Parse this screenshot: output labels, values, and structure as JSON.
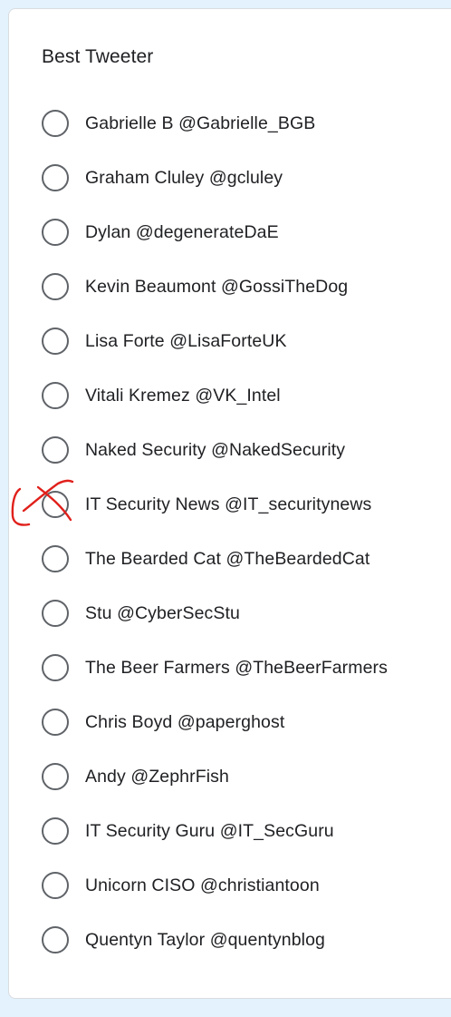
{
  "question": {
    "title": "Best Tweeter"
  },
  "options": [
    {
      "label": "Gabrielle B @Gabrielle_BGB"
    },
    {
      "label": "Graham Cluley @gcluley"
    },
    {
      "label": "Dylan @degenerateDaE"
    },
    {
      "label": "Kevin Beaumont @GossiTheDog"
    },
    {
      "label": "Lisa Forte @LisaForteUK"
    },
    {
      "label": "Vitali Kremez @VK_Intel"
    },
    {
      "label": "Naked Security @NakedSecurity"
    },
    {
      "label": "IT Security News @IT_securitynews"
    },
    {
      "label": "The Bearded Cat @TheBeardedCat"
    },
    {
      "label": "Stu @CyberSecStu"
    },
    {
      "label": "The Beer Farmers @TheBeerFarmers"
    },
    {
      "label": "Chris Boyd @paperghost"
    },
    {
      "label": "Andy @ZephrFish"
    },
    {
      "label": "IT Security Guru @IT_SecGuru"
    },
    {
      "label": "Unicorn CISO @christiantoon"
    },
    {
      "label": "Quentyn Taylor @quentynblog"
    }
  ],
  "annotation": {
    "type": "handwritten-cross",
    "color": "#e0201b",
    "marked_option": "IT Security News @IT_securitynews"
  },
  "colors": {
    "page_background": "#e3f2fc",
    "card_background": "#ffffff",
    "radio_border": "#5f6368",
    "text": "#202124"
  }
}
